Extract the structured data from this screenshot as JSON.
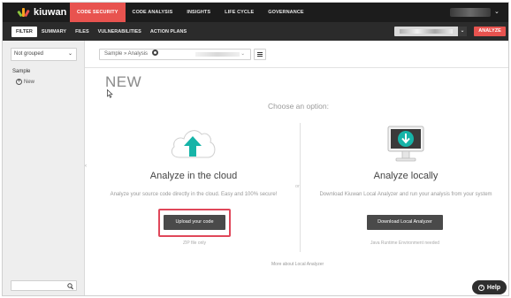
{
  "brand": {
    "name": "kiuwan"
  },
  "top_nav": {
    "tabs": [
      {
        "label": "CODE SECURITY",
        "active": true
      },
      {
        "label": "CODE ANALYSIS",
        "active": false
      },
      {
        "label": "INSIGHTS",
        "active": false
      },
      {
        "label": "LIFE CYCLE",
        "active": false
      },
      {
        "label": "GOVERNANCE",
        "active": false
      }
    ],
    "user_chevron": "⌄"
  },
  "sub_nav": {
    "tabs": [
      {
        "label": "FILTER",
        "active": true
      },
      {
        "label": "SUMMARY",
        "active": false
      },
      {
        "label": "FILES",
        "active": false
      },
      {
        "label": "VULNERABILITIES",
        "active": false
      },
      {
        "label": "ACTION PLANS",
        "active": false
      }
    ],
    "project_chevron": "⌄",
    "analyze_label": "ANALYZE"
  },
  "sidebar": {
    "group_select": {
      "value": "Not grouped",
      "chevron": "⌄"
    },
    "tree": {
      "root": "Sample",
      "child": "New"
    },
    "collapse_icon": "‹"
  },
  "toolbar": {
    "analysis_select": {
      "value": "Sample » Analysis",
      "chevron": "⌄"
    }
  },
  "main": {
    "title": "NEW",
    "choose_label": "Choose an option:",
    "or_label": "or",
    "cloud": {
      "title": "Analyze in the cloud",
      "description": "Analyze your source code directly in the cloud. Easy and 100% secure!",
      "button": "Upload your code",
      "note": "ZIP file only"
    },
    "local": {
      "title": "Analyze locally",
      "description": "Download Kiuwan Local Analyzer and run your analysis from your system",
      "button": "Download Local Analyzer",
      "note": "Java Runtime Environment needed"
    },
    "more_link": "More about Local Analyzer"
  },
  "help": {
    "label": "Help",
    "icon": "?"
  },
  "colors": {
    "accent": "#e8534f",
    "teal": "#16b4a8",
    "highlight": "#e0475a",
    "dark": "#1c1c1c"
  }
}
